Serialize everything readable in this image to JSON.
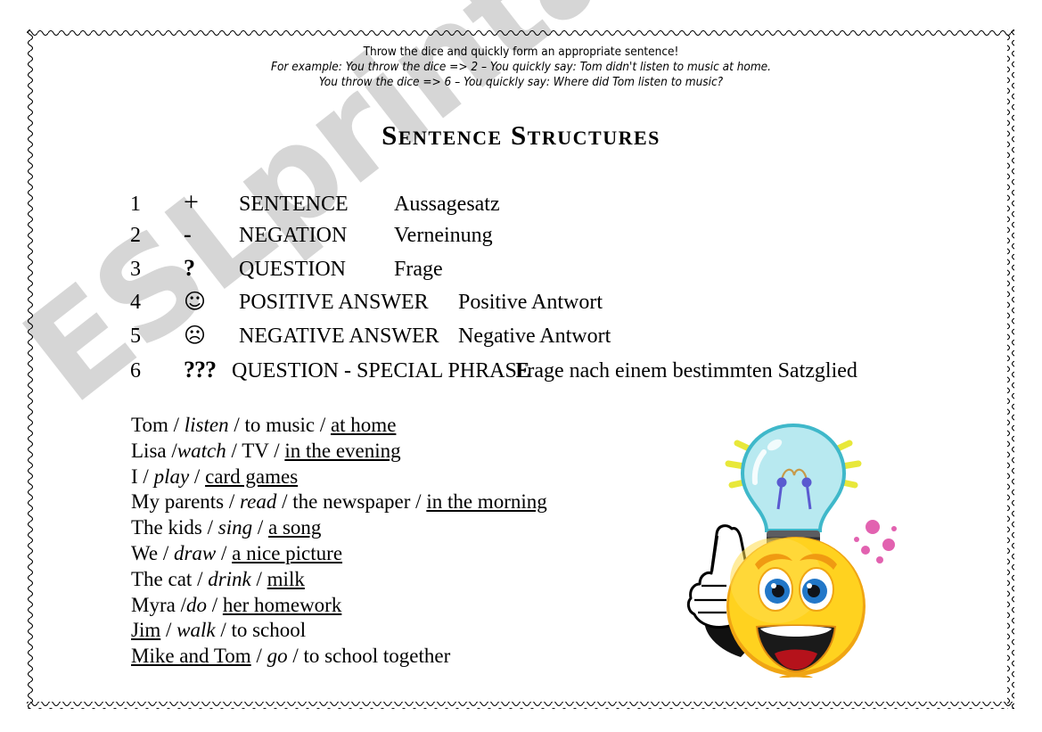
{
  "worksheet": {
    "header": {
      "line1": "Throw the dice and quickly form an appropriate sentence!",
      "line2": "For example: You throw the dice => 2 – You quickly say: Tom didn't listen to music at home.",
      "line3": "You throw the dice => 6 – You quickly say: Where did Tom listen to music?"
    },
    "title": "Sentence Structures",
    "watermark": "ESLprintables.com",
    "key_rows": [
      {
        "num": "1",
        "symbol": "+",
        "symbol_name": "plus-sign",
        "english": "SENTENCE",
        "german": "Aussagesatz"
      },
      {
        "num": "2",
        "symbol": "-",
        "symbol_name": "minus-sign",
        "english": "NEGATION",
        "german": "Verneinung"
      },
      {
        "num": "3",
        "symbol": "?",
        "symbol_name": "question-mark",
        "english": "QUESTION",
        "german": "Frage"
      },
      {
        "num": "4",
        "symbol": "☺",
        "symbol_name": "smiley-face-icon",
        "english": "POSITIVE ANSWER",
        "german": "Positive Antwort"
      },
      {
        "num": "5",
        "symbol": "☹",
        "symbol_name": "frowning-face-icon",
        "english": "NEGATIVE ANSWER",
        "german": "Negative Antwort"
      },
      {
        "num": "6",
        "symbol": "???",
        "symbol_name": "triple-question-mark",
        "english": "QUESTION - SPECIAL PHRASE",
        "german": "Frage nach einem bestimmten Satzglied"
      }
    ],
    "sentences": [
      {
        "subject": "Tom",
        "subject_underlined": false,
        "verb": "listen",
        "rest": "to music",
        "phrase": "at home"
      },
      {
        "subject": "Lisa",
        "subject_underlined": false,
        "verb": "watch",
        "rest": "TV",
        "phrase": "in the evening",
        "compact_verb": true
      },
      {
        "subject": "I",
        "subject_underlined": false,
        "verb": "play",
        "rest": "",
        "phrase": "card games"
      },
      {
        "subject": "My parents",
        "subject_underlined": false,
        "verb": "read",
        "rest": "the newspaper",
        "phrase": "in the morning"
      },
      {
        "subject": "The kids",
        "subject_underlined": false,
        "verb": "sing",
        "rest": "",
        "phrase": "a song"
      },
      {
        "subject": "We",
        "subject_underlined": false,
        "verb": "draw",
        "rest": "",
        "phrase": "a nice picture"
      },
      {
        "subject": "The cat",
        "subject_underlined": false,
        "verb": "drink",
        "rest": "",
        "phrase": "milk"
      },
      {
        "subject": "Myra",
        "subject_underlined": false,
        "verb": "do",
        "rest": "",
        "phrase": "her homework",
        "compact_verb": true
      },
      {
        "subject": "Jim",
        "subject_underlined": true,
        "verb": "walk",
        "rest": "to school",
        "phrase": ""
      },
      {
        "subject": "Mike and Tom",
        "subject_underlined": true,
        "verb": "go",
        "rest": "to school together",
        "phrase": ""
      }
    ],
    "illustration": {
      "name": "smiley-with-lightbulb-idea",
      "face_color": "#ffd21f",
      "face_shadow": "#f0a513",
      "bulb_color": "#aee8ef",
      "bulb_outline": "#38b6c8",
      "ray_color": "#e8e83a",
      "base_color": "#58585c",
      "eye_color": "#2277c8",
      "mouth_color": "#b5121b",
      "dot_color": "#e262b0"
    },
    "colors": {
      "text": "#000000",
      "background": "#ffffff",
      "watermark": "#d6d6d6",
      "border": "#000000"
    }
  }
}
